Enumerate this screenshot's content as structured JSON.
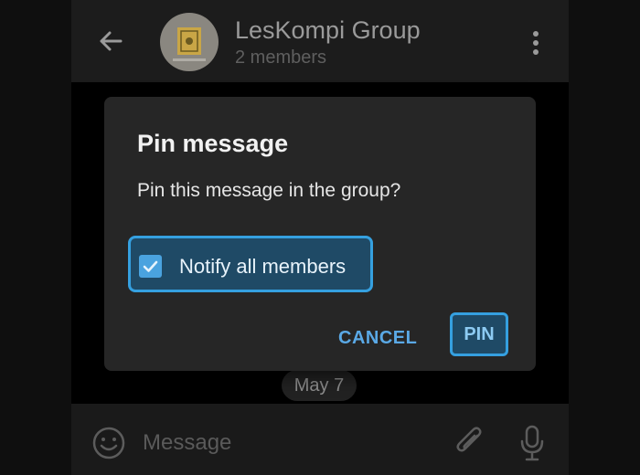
{
  "header": {
    "title": "LesKompi Group",
    "subtitle": "2 members",
    "back_icon": "arrow-left-icon",
    "menu_icon": "more-vertical-icon"
  },
  "chat": {
    "date_chip": "May 7"
  },
  "input_bar": {
    "placeholder": "Message",
    "emoji_icon": "emoji-icon",
    "attach_icon": "paperclip-icon",
    "mic_icon": "microphone-icon"
  },
  "dialog": {
    "title": "Pin message",
    "body": "Pin this message in the group?",
    "notify_label": "Notify all members",
    "notify_checked": true,
    "cancel_label": "CANCEL",
    "pin_label": "PIN"
  },
  "colors": {
    "accent": "#35a0e0",
    "dialog_bg": "#262626",
    "button_text": "#5aa9e6"
  }
}
